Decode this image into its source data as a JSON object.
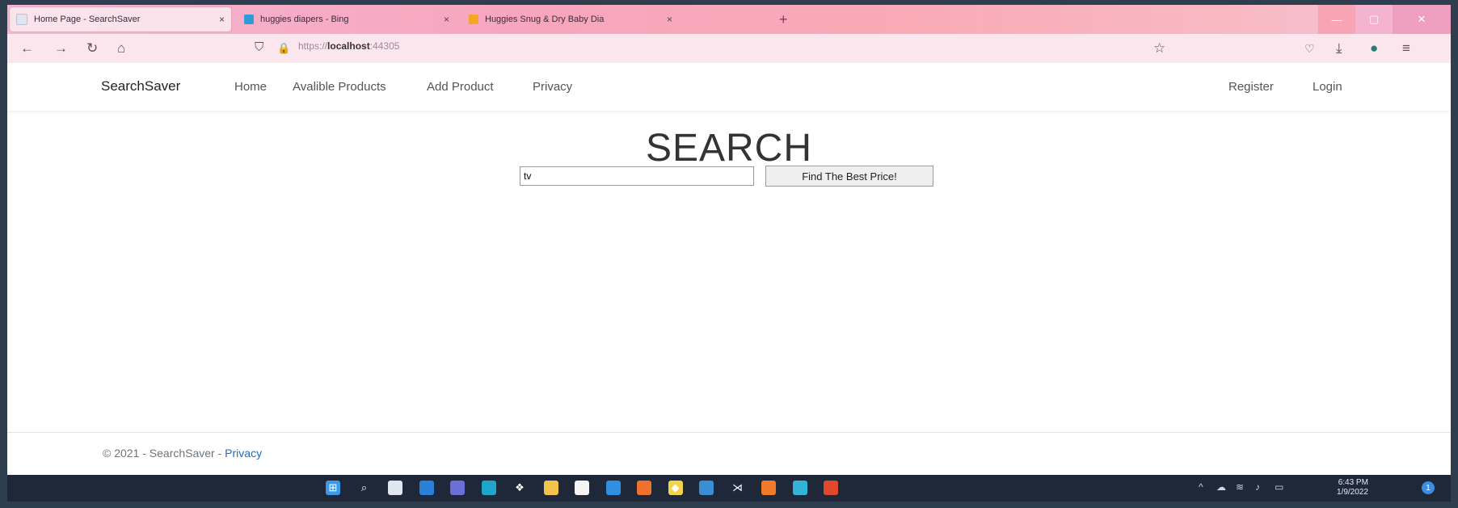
{
  "browser": {
    "tabs": [
      {
        "title": "Home Page - SearchSaver",
        "close": "×",
        "favicon_color": "#dfe6f0"
      },
      {
        "title": "huggies diapers - Bing",
        "close": "×",
        "favicon_color": "#2b9cd8"
      },
      {
        "title": "Huggies Snug & Dry Baby Dia",
        "close": "×",
        "favicon_color": "#f5a623"
      }
    ],
    "new_tab": "+",
    "url_prefix": "https://",
    "url_host": "localhost",
    "url_port": ":44305",
    "icons": {
      "back": "←",
      "forward": "→",
      "reload": "↻",
      "home": "⌂",
      "shield": "⛉",
      "lock": "🔒",
      "star": "☆",
      "pocket": "♡",
      "download": "⤓",
      "account": "●",
      "menu": "≡"
    },
    "window": {
      "minimize": "—",
      "maximize": "▢",
      "close": "✕"
    }
  },
  "site": {
    "brand": "SearchSaver",
    "nav": [
      "Home",
      "Avalible Products",
      "Add Product",
      "Privacy"
    ],
    "auth": [
      "Register",
      "Login"
    ],
    "heading": "SEARCH",
    "search_value": "tv",
    "search_button": "Find The Best Price!",
    "footer_text": "© 2021 - SearchSaver - ",
    "footer_link": "Privacy"
  },
  "taskbar": {
    "time": "6:43 PM",
    "date": "1/9/2022",
    "notification_count": "1",
    "tray_chevron": "^",
    "icons": [
      {
        "name": "start",
        "color": "#3b9ae8",
        "glyph": "⊞"
      },
      {
        "name": "search",
        "color": "transparent",
        "glyph": "⌕"
      },
      {
        "name": "task-view",
        "color": "#dfe6f0",
        "glyph": ""
      },
      {
        "name": "widgets",
        "color": "#2a7fd6",
        "glyph": ""
      },
      {
        "name": "teams-chat",
        "color": "#6b6fd8",
        "glyph": ""
      },
      {
        "name": "edge",
        "color": "#1ea5c9",
        "glyph": ""
      },
      {
        "name": "dropbox",
        "color": "transparent",
        "glyph": "❖"
      },
      {
        "name": "file-explorer",
        "color": "#f2c24b",
        "glyph": ""
      },
      {
        "name": "store",
        "color": "#f5f5f5",
        "glyph": ""
      },
      {
        "name": "mail",
        "color": "#2f8fe0",
        "glyph": ""
      },
      {
        "name": "firefox",
        "color": "#f0712c",
        "glyph": ""
      },
      {
        "name": "git-app",
        "color": "#f3d34a",
        "glyph": "◆"
      },
      {
        "name": "remote-app",
        "color": "#3a8ed6",
        "glyph": ""
      },
      {
        "name": "visual-studio",
        "color": "transparent",
        "glyph": "⋊"
      },
      {
        "name": "app-orange",
        "color": "#f07a2a",
        "glyph": ""
      },
      {
        "name": "app-teal",
        "color": "#34b3d9",
        "glyph": ""
      },
      {
        "name": "powerpoint",
        "color": "#e0472b",
        "glyph": ""
      }
    ]
  }
}
